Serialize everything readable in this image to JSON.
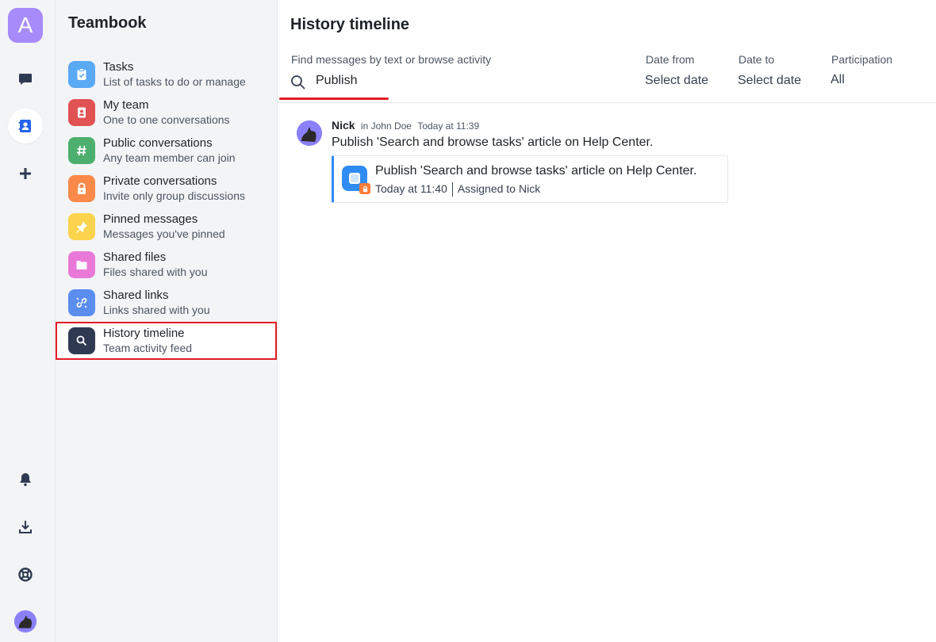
{
  "rail": {
    "workspace_letter": "A",
    "icons": [
      "chat-icon",
      "contacts-icon",
      "plus-icon",
      "bell-icon",
      "download-icon",
      "lifebuoy-icon",
      "user-avatar"
    ]
  },
  "sidebar": {
    "title": "Teambook",
    "items": [
      {
        "title": "Tasks",
        "subtitle": "List of tasks to do or manage",
        "icon": "clipboard-check-icon",
        "color": "#5aa9f5"
      },
      {
        "title": "My team",
        "subtitle": "One to one conversations",
        "icon": "contact-book-icon",
        "color": "#e15252"
      },
      {
        "title": "Public conversations",
        "subtitle": "Any team member can join",
        "icon": "hash-icon",
        "color": "#4caf6e"
      },
      {
        "title": "Private conversations",
        "subtitle": "Invite only group discussions",
        "icon": "lock-icon",
        "color": "#fb8a4a"
      },
      {
        "title": "Pinned messages",
        "subtitle": "Messages you've pinned",
        "icon": "pin-icon",
        "color": "#fcd34d"
      },
      {
        "title": "Shared files",
        "subtitle": "Files shared with you",
        "icon": "folder-icon",
        "color": "#e879d9"
      },
      {
        "title": "Shared links",
        "subtitle": "Links shared with you",
        "icon": "link-icon",
        "color": "#5b8def"
      },
      {
        "title": "History timeline",
        "subtitle": "Team activity feed",
        "icon": "search-icon",
        "color": "#2f3a52"
      }
    ]
  },
  "main": {
    "title": "History timeline",
    "search": {
      "label": "Find messages by text or browse activity",
      "value": "Publish"
    },
    "date_from": {
      "label": "Date from",
      "value": "Select date"
    },
    "date_to": {
      "label": "Date to",
      "value": "Select date"
    },
    "participation": {
      "label": "Participation",
      "value": "All"
    },
    "message": {
      "author": "Nick",
      "context": "in John Doe",
      "time": "Today at 11:39",
      "text": "Publish 'Search and browse tasks' article on Help Center.",
      "task": {
        "title": "Publish 'Search and browse tasks' article on Help Center.",
        "time": "Today at 11:40",
        "assigned_label": "Assigned to",
        "assignee": "Nick"
      }
    }
  },
  "colors": {
    "accent": "#2f8cf5",
    "highlight": "#e11d24",
    "workspace": "#a78bfa"
  }
}
